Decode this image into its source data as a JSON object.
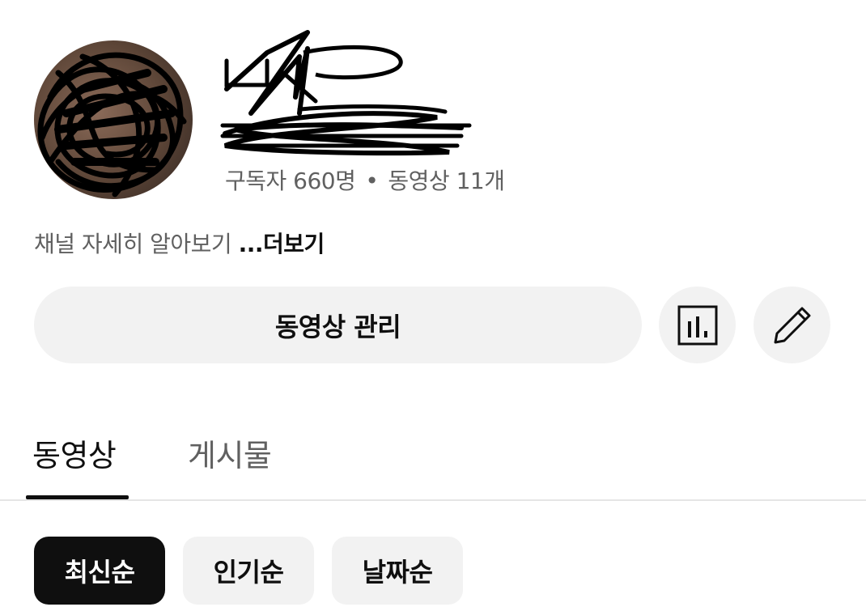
{
  "channel": {
    "stats": {
      "subscribers": "구독자 660명",
      "separator": "•",
      "videos": "동영상 11개"
    },
    "description": {
      "text": "채널 자세히 알아보기",
      "more_label": "...더보기"
    }
  },
  "actions": {
    "manage_videos_label": "동영상 관리",
    "stats_icon": "analytics-icon",
    "edit_icon": "pencil-icon"
  },
  "tabs": [
    {
      "label": "동영상",
      "selected": true
    },
    {
      "label": "게시물",
      "selected": false
    }
  ],
  "sort_chips": [
    {
      "label": "최신순",
      "selected": true
    },
    {
      "label": "인기순",
      "selected": false
    },
    {
      "label": "날짜순",
      "selected": false
    }
  ],
  "colors": {
    "text_primary": "#0f0f0f",
    "text_secondary": "#606060",
    "chip_bg": "#f2f2f2",
    "chip_selected_bg": "#0f0f0f"
  }
}
